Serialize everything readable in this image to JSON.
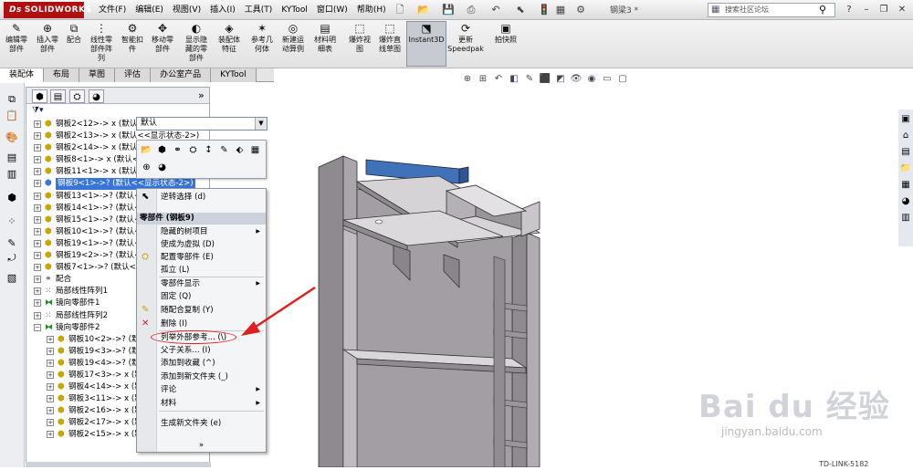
{
  "app": {
    "brand": "SOLIDWORKS",
    "doc_title": "钢梁3 *"
  },
  "menu": [
    "文件(F)",
    "编辑(E)",
    "视图(V)",
    "插入(I)",
    "工具(T)",
    "KYTool",
    "窗口(W)",
    "帮助(H)"
  ],
  "search": {
    "placeholder": "搜索社区论坛"
  },
  "toolbar": [
    {
      "label": "编辑零\n部件",
      "icon": "edit-component-icon",
      "glyph": "✎"
    },
    {
      "label": "插入零\n部件",
      "icon": "insert-component-icon",
      "glyph": "⊕"
    },
    {
      "label": "配合",
      "icon": "mate-icon",
      "glyph": "⧉"
    },
    {
      "label": "线性零\n部件阵\n列",
      "icon": "linear-pattern-icon",
      "glyph": "⋮"
    },
    {
      "label": "智能扣\n件",
      "icon": "smart-fastener-icon",
      "glyph": "⚙"
    },
    {
      "label": "移动零\n部件",
      "icon": "move-component-icon",
      "glyph": "✥"
    },
    {
      "label": "显示隐\n藏的零\n部件",
      "icon": "show-hidden-icon",
      "glyph": "◐"
    },
    {
      "label": "装配体\n特征",
      "icon": "assembly-feature-icon",
      "glyph": "◈"
    },
    {
      "label": "参考几\n何体",
      "icon": "reference-geometry-icon",
      "glyph": "✶"
    },
    {
      "label": "新建运\n动算例",
      "icon": "motion-study-icon",
      "glyph": "◎"
    },
    {
      "label": "材料明\n细表",
      "icon": "bom-icon",
      "glyph": "▤"
    },
    {
      "label": "爆炸视\n图",
      "icon": "exploded-view-icon",
      "glyph": "⬚"
    },
    {
      "label": "爆炸直\n线草图",
      "icon": "explode-line-icon",
      "glyph": "⬚"
    },
    {
      "label": "Instant3D",
      "icon": "instant3d-icon",
      "glyph": "⬔"
    },
    {
      "label": "更新\nSpeedpak",
      "icon": "speedpak-icon",
      "glyph": "⟳"
    },
    {
      "label": "拍快照",
      "icon": "snapshot-icon",
      "glyph": "▣"
    }
  ],
  "tabs": [
    "装配体",
    "布局",
    "草图",
    "评估",
    "办公室产品",
    "KYTool"
  ],
  "combo": {
    "value": "默认"
  },
  "tree": [
    {
      "label": "钢板2<12>-> x (默认<",
      "indent": 0,
      "type": "part"
    },
    {
      "label": "钢板2<13>-> x (默认<<显示状态-2>)",
      "indent": 0,
      "type": "part"
    },
    {
      "label": "钢板2<14>-> x (默认<",
      "indent": 0,
      "type": "part"
    },
    {
      "label": "钢板8<1>-> x (默认<",
      "indent": 0,
      "type": "part"
    },
    {
      "label": "钢板11<1>-> x (默认<",
      "indent": 0,
      "type": "part"
    },
    {
      "label": "钢板9<1>->? (默认<<显示状态-2>)",
      "indent": 0,
      "type": "part",
      "highlight": true
    },
    {
      "label": "钢板13<1>->? (默认<",
      "indent": 0,
      "type": "part"
    },
    {
      "label": "钢板14<1>->? (默认<",
      "indent": 0,
      "type": "part"
    },
    {
      "label": "钢板15<1>->? (默认<",
      "indent": 0,
      "type": "part"
    },
    {
      "label": "钢板10<1>->? (默认<",
      "indent": 0,
      "type": "part"
    },
    {
      "label": "钢板19<1>->? (默认<",
      "indent": 0,
      "type": "part"
    },
    {
      "label": "钢板19<2>->? (默认<",
      "indent": 0,
      "type": "part"
    },
    {
      "label": "钢板7<1>->? (默认<",
      "indent": 0,
      "type": "part"
    },
    {
      "label": "配合",
      "indent": 0,
      "type": "mate"
    },
    {
      "label": "局部线性阵列1",
      "indent": 0,
      "type": "pattern"
    },
    {
      "label": "镜向零部件1",
      "indent": 0,
      "type": "mirror"
    },
    {
      "label": "局部线性阵列2",
      "indent": 0,
      "type": "pattern"
    },
    {
      "label": "镜向零部件2",
      "indent": 0,
      "type": "mirror",
      "expanded": true
    },
    {
      "label": "钢板10<2>->? (默",
      "indent": 1,
      "type": "part"
    },
    {
      "label": "钢板19<3>->? (默",
      "indent": 1,
      "type": "part"
    },
    {
      "label": "钢板19<4>->? (默",
      "indent": 1,
      "type": "part"
    },
    {
      "label": "钢板17<3>-> x (默",
      "indent": 1,
      "type": "part"
    },
    {
      "label": "钢板4<14>-> x (默",
      "indent": 1,
      "type": "part"
    },
    {
      "label": "钢板3<11>-> x (默",
      "indent": 1,
      "type": "part"
    },
    {
      "label": "钢板2<16>-> x (默",
      "indent": 1,
      "type": "part"
    },
    {
      "label": "钢板2<17>-> x (默",
      "indent": 1,
      "type": "part"
    },
    {
      "label": "钢板2<15>-> x (默",
      "indent": 1,
      "type": "part"
    }
  ],
  "context_menu": {
    "top_item": "逆转选择 (d)",
    "header": "零部件 (钢板9)",
    "items": [
      {
        "label": "隐藏的树项目",
        "submenu": true
      },
      {
        "label": "使成为虚拟 (D)"
      },
      {
        "label": "配置零部件 (E)"
      },
      {
        "label": "孤立 (L)"
      },
      {
        "label": "零部件显示",
        "submenu": true
      },
      {
        "label": "固定 (Q)"
      },
      {
        "label": "随配合复制 (Y)"
      },
      {
        "label": "删除 (I)"
      },
      {
        "label": "列举外部参考... (\\)"
      },
      {
        "label": "父子关系... (I)"
      },
      {
        "label": "添加到收藏 (^)"
      },
      {
        "label": "添加到新文件夹 (_)"
      },
      {
        "label": "评论",
        "submenu": true
      },
      {
        "label": "材料",
        "submenu": true
      }
    ],
    "bottom_item": "生成新文件夹 (e)",
    "more": "»"
  },
  "watermark": {
    "logo": "Bai du 经验",
    "site": "jingyan.baidu.com"
  },
  "corner_text": "TD-LINK-5182",
  "colors": {
    "highlight": "#3875d7",
    "annotation": "#e02020",
    "brand": "#b01010",
    "model": "#a39ea3"
  }
}
